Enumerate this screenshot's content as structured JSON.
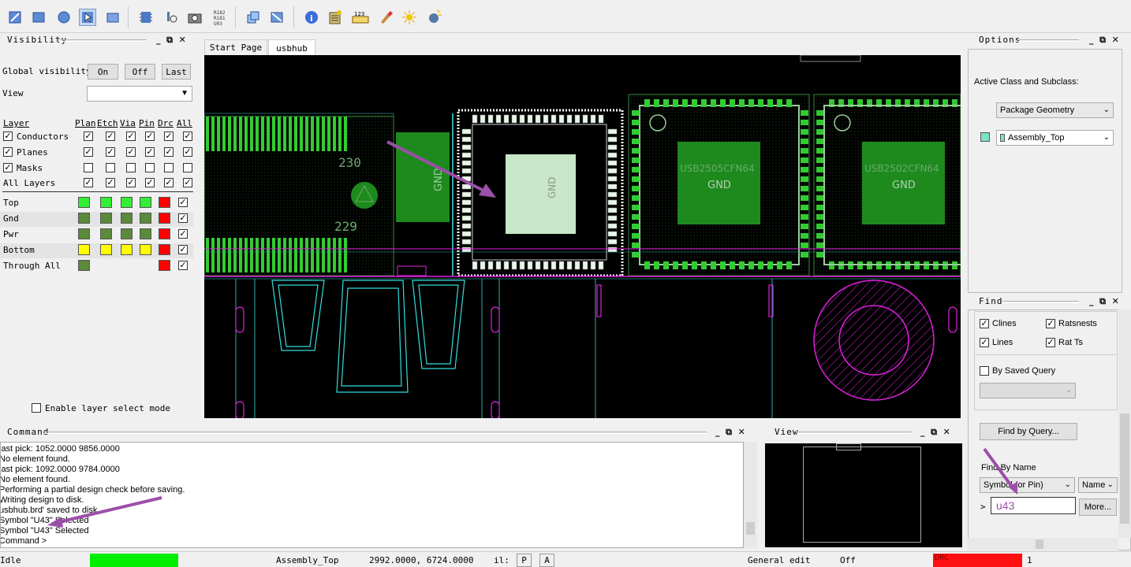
{
  "visibility": {
    "title": "Visibility",
    "global_label": "Global visibility",
    "on": "On",
    "off": "Off",
    "last": "Last",
    "view_label": "View",
    "headers": {
      "layer": "Layer",
      "plan": "Plan",
      "etch": "Etch",
      "via": "Via",
      "pin": "Pin",
      "drc": "Drc",
      "all": "All"
    },
    "groups": [
      {
        "name": "Conductors",
        "checked": true,
        "cols": [
          true,
          true,
          true,
          true,
          true,
          true
        ]
      },
      {
        "name": "Planes",
        "checked": true,
        "cols": [
          true,
          true,
          true,
          true,
          true,
          true
        ]
      },
      {
        "name": "Masks",
        "checked": true,
        "cols": [
          false,
          false,
          false,
          false,
          false,
          false
        ]
      },
      {
        "name": "All Layers",
        "checked": false,
        "cols": [
          true,
          true,
          true,
          true,
          true,
          true
        ]
      }
    ],
    "layers": [
      {
        "name": "Top",
        "colors": [
          "#33ee33",
          "#33ee33",
          "#33ee33",
          "#33ee33",
          "#ff0000"
        ],
        "all": true
      },
      {
        "name": "Gnd",
        "colors": [
          "#5a8a3a",
          "#5a8a3a",
          "#5a8a3a",
          "#5a8a3a",
          "#ff0000"
        ],
        "all": true
      },
      {
        "name": "Pwr",
        "colors": [
          "#5a8a3a",
          "#5a8a3a",
          "#5a8a3a",
          "#5a8a3a",
          "#ff0000"
        ],
        "all": true
      },
      {
        "name": "Bottom",
        "colors": [
          "#ffff00",
          "#ffff00",
          "#ffff00",
          "#ffff00",
          "#ff0000"
        ],
        "all": true
      },
      {
        "name": "Through All",
        "colors": [
          "#5a8a3a",
          null,
          null,
          null,
          "#ff0000"
        ],
        "all": true
      }
    ],
    "enable_select": "Enable layer select mode"
  },
  "tabs": [
    "Start Page",
    "usbhub"
  ],
  "canvas": {
    "labels": {
      "gnd1": "GND",
      "n230": "230",
      "n229": "229",
      "gnd2": "GND",
      "part1": "USB2505CFN64",
      "gnd3": "GND",
      "part2": "USB2502CFN64",
      "gnd4": "GND"
    }
  },
  "options": {
    "title": "Options",
    "active_label": "Active Class and Subclass:",
    "class_value": "Package Geometry",
    "subclass_value": "Assembly_Top"
  },
  "find": {
    "title": "Find",
    "items": [
      {
        "label": "Clines",
        "checked": true
      },
      {
        "label": "Ratsnests",
        "checked": true
      },
      {
        "label": "Lines",
        "checked": true
      },
      {
        "label": "Rat Ts",
        "checked": true
      }
    ],
    "by_saved_query": "By Saved Query",
    "find_by_query": "Find by Query...",
    "find_by_name": "Find By Name",
    "symbol_select": "Symbol (or Pin)",
    "name_select": "Name",
    "name_value": "u43",
    "more": "More...",
    "chevron": ">"
  },
  "command": {
    "title": "Command",
    "lines": [
      "last pick:  1052.0000 9856.0000",
      "No element found.",
      "last pick:  1092.0000 9784.0000",
      "No element found.",
      "Performing a partial design check before saving.",
      "Writing design to disk.",
      "usbhub.brd' saved to disk.",
      "Symbol \"U43\" Selected",
      "Symbol \"U43\" Selected",
      "Command >"
    ]
  },
  "view": {
    "title": "View"
  },
  "status": {
    "state": "Idle",
    "subclass": "Assembly_Top",
    "coords": "2992.0000, 6724.0000",
    "unit": "il:",
    "p": "P",
    "a": "A",
    "mode": "General edit",
    "off": "Off",
    "drc": "DRC",
    "count": "1"
  },
  "colors": {
    "accent_arrow": "#9b4fa8",
    "pcb_green": "#1e8a1e",
    "copper_bright": "#33dd33",
    "outline_cyan": "#33dddd",
    "magenta": "#dd22dd"
  }
}
